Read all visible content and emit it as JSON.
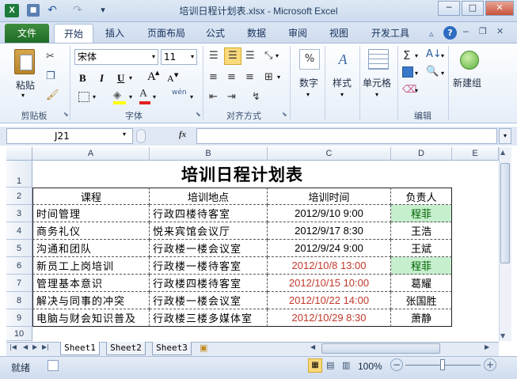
{
  "window": {
    "title": "培训日程计划表.xlsx - Microsoft Excel"
  },
  "quick_access": {
    "undo": "↶",
    "redo": "↷",
    "more": "▾"
  },
  "ribbon_tabs": [
    "文件",
    "开始",
    "插入",
    "页面布局",
    "公式",
    "数据",
    "审阅",
    "视图",
    "开发工具"
  ],
  "ribbon": {
    "paste_label": "粘贴",
    "clipboard_label": "剪贴板",
    "font_name": "宋体",
    "font_size": "11",
    "font_group_label": "字体",
    "align_group_label": "对齐方式",
    "number_label": "数字",
    "style_label": "样式",
    "cells_label": "单元格",
    "edit_group_label": "编辑",
    "new_group_label": "新建组",
    "bold": "B",
    "italic": "I",
    "underline": "U",
    "grow": "A",
    "shrink": "A",
    "wen": "wén"
  },
  "formula_bar": {
    "name_box": "J21",
    "fx": "fx",
    "content": ""
  },
  "columns": [
    "A",
    "B",
    "C",
    "D",
    "E"
  ],
  "rows": [
    "1",
    "2",
    "3",
    "4",
    "5",
    "6",
    "7",
    "8",
    "9",
    "10"
  ],
  "sheet": {
    "title": "培训日程计划表",
    "headers": [
      "课程",
      "培训地点",
      "培训时间",
      "负责人"
    ],
    "data": [
      {
        "course": "时间管理",
        "place": "行政四楼待客室",
        "time": "2012/9/10 9:00",
        "owner": "程菲",
        "highlight": true,
        "time_red": false
      },
      {
        "course": "商务礼仪",
        "place": "悦来宾馆会议厅",
        "time": "2012/9/17 8:30",
        "owner": "王浩",
        "highlight": false,
        "time_red": false
      },
      {
        "course": "沟通和团队",
        "place": "行政楼一楼会议室",
        "time": "2012/9/24 9:00",
        "owner": "王斌",
        "highlight": false,
        "time_red": false
      },
      {
        "course": "新员工上岗培训",
        "place": "行政楼一楼待客室",
        "time": "2012/10/8 13:00",
        "owner": "程菲",
        "highlight": true,
        "time_red": true
      },
      {
        "course": "管理基本意识",
        "place": "行政楼四楼待客室",
        "time": "2012/10/15 10:00",
        "owner": "葛耀",
        "highlight": false,
        "time_red": true
      },
      {
        "course": "解决与同事的冲突",
        "place": "行政楼一楼会议室",
        "time": "2012/10/22 14:00",
        "owner": "张国胜",
        "highlight": false,
        "time_red": true
      },
      {
        "course": "电脑与财会知识普及",
        "place": "行政楼三楼多媒体室",
        "time": "2012/10/29 8:30",
        "owner": "萧静",
        "highlight": false,
        "time_red": true
      }
    ]
  },
  "sheet_tabs": [
    "Sheet1",
    "Sheet2",
    "Sheet3"
  ],
  "status": {
    "ready": "就绪",
    "zoom": "100%"
  },
  "colors": {
    "highlight": "#c6efce",
    "highlight_text": "#006100",
    "red_text": "#c0392b"
  }
}
